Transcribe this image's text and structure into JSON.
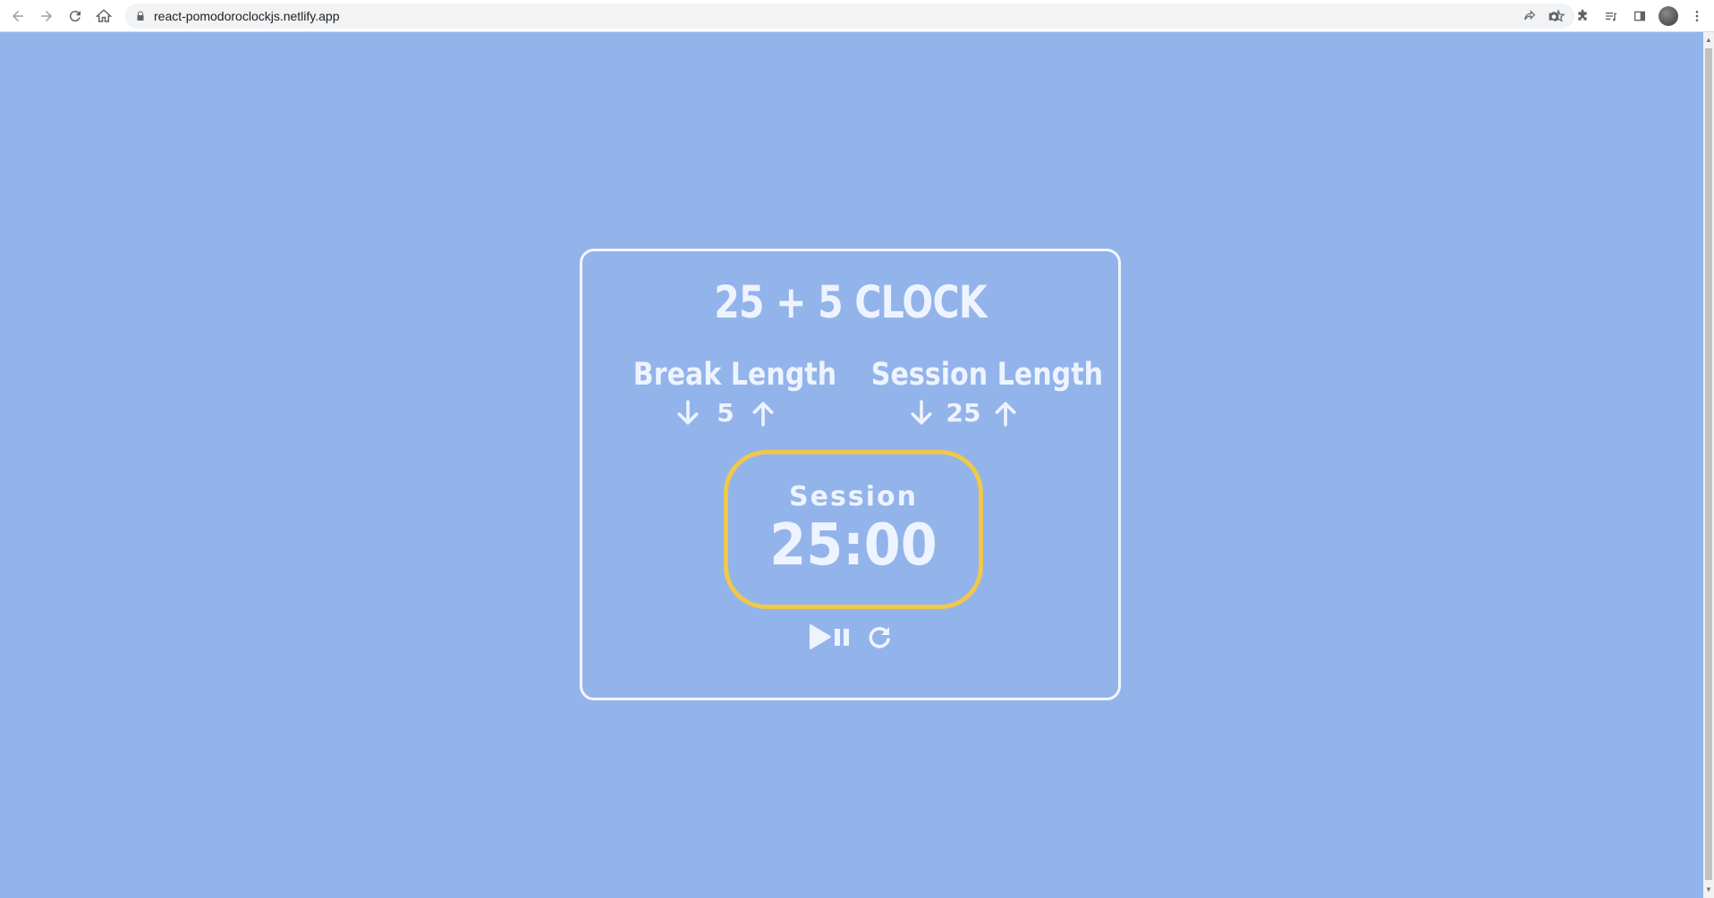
{
  "browser": {
    "url": "react-pomodoroclockjs.netlify.app"
  },
  "app": {
    "title": "25 + 5 CLOCK",
    "break": {
      "label": "Break Length",
      "value": "5"
    },
    "session": {
      "label": "Session Length",
      "value": "25"
    },
    "timer": {
      "label": "Session",
      "time_left": "25:00"
    }
  },
  "colors": {
    "background": "#93b3eb",
    "text": "#eef4ff",
    "timer_border": "#f0c94a",
    "card_border": "#f2f6ff"
  },
  "icons": {
    "decrement": "arrow-down-icon",
    "increment": "arrow-up-icon",
    "start_stop": "play-pause-icon",
    "reset": "refresh-icon"
  }
}
